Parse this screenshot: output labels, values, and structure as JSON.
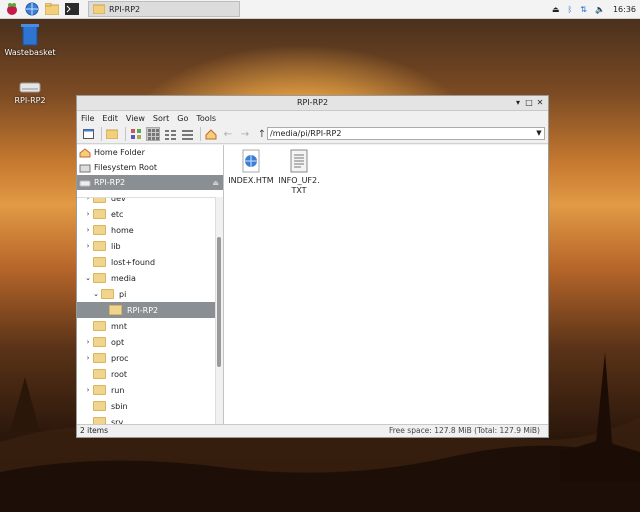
{
  "taskbar": {
    "task_label": "RPI-RP2",
    "clock": "16:36"
  },
  "desktop": {
    "icons": [
      {
        "label": "Wastebasket",
        "icon": "trash-icon"
      },
      {
        "label": "RPI-RP2",
        "icon": "drive-icon"
      }
    ]
  },
  "window": {
    "title": "RPI-RP2",
    "menu": [
      "File",
      "Edit",
      "View",
      "Sort",
      "Go",
      "Tools"
    ],
    "path": "/media/pi/RPI-RP2",
    "places": [
      {
        "label": "Home Folder",
        "icon": "home-icon"
      },
      {
        "label": "Filesystem Root",
        "icon": "disk-icon"
      },
      {
        "label": "RPI-RP2",
        "icon": "usb-drive-icon"
      }
    ],
    "tree": [
      {
        "label": "dev",
        "expander": "›"
      },
      {
        "label": "etc",
        "expander": "›"
      },
      {
        "label": "home",
        "expander": "›"
      },
      {
        "label": "lib",
        "expander": "›"
      },
      {
        "label": "lost+found",
        "expander": ""
      },
      {
        "label": "media",
        "expander": "⌄"
      },
      {
        "label": "pi",
        "expander": "⌄"
      },
      {
        "label": "RPI-RP2",
        "expander": ""
      },
      {
        "label": "mnt",
        "expander": ""
      },
      {
        "label": "opt",
        "expander": "›"
      },
      {
        "label": "proc",
        "expander": "›"
      },
      {
        "label": "root",
        "expander": ""
      },
      {
        "label": "run",
        "expander": "›"
      },
      {
        "label": "sbin",
        "expander": ""
      },
      {
        "label": "srv",
        "expander": ""
      }
    ],
    "files": [
      {
        "name": "INDEX.HTM",
        "icon": "web-file-icon"
      },
      {
        "name": "INFO_UF2.TXT",
        "icon": "text-file-icon"
      }
    ],
    "status_left": "2 items",
    "status_right": "Free space: 127.8 MiB (Total: 127.9 MiB)"
  }
}
